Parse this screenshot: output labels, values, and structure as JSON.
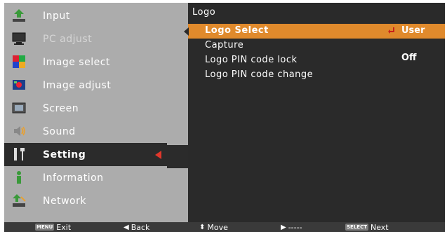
{
  "menu": {
    "items": [
      {
        "label": "Input",
        "icon": "input-icon"
      },
      {
        "label": "PC adjust",
        "icon": "pc-adjust-icon"
      },
      {
        "label": "Image select",
        "icon": "image-select-icon"
      },
      {
        "label": "Image adjust",
        "icon": "image-adjust-icon"
      },
      {
        "label": "Screen",
        "icon": "screen-icon"
      },
      {
        "label": "Sound",
        "icon": "sound-icon"
      },
      {
        "label": "Setting",
        "icon": "setting-icon"
      },
      {
        "label": "Information",
        "icon": "information-icon"
      },
      {
        "label": "Network",
        "icon": "network-icon"
      }
    ],
    "selected_index": 6
  },
  "panel": {
    "title": "Logo",
    "rows": [
      {
        "label": "Logo Select",
        "value": "User",
        "highlighted": true
      },
      {
        "label": "Capture",
        "value": ""
      },
      {
        "label": "Logo PIN code lock",
        "value": "Off"
      },
      {
        "label": "Logo PIN code change",
        "value": ""
      }
    ]
  },
  "bottom_bar": {
    "exit_key": "MENU",
    "exit_label": "Exit",
    "back_glyph": "◀",
    "back_label": "Back",
    "move_glyph": "⬍",
    "move_label": "Move",
    "next_glyph": "▶",
    "next_label": "-----",
    "select_key": "SELECT",
    "select_label": "Next"
  },
  "colors": {
    "osd_bg": "#acacac",
    "panel_bg": "#2a2a2a",
    "highlight": "#e08a2c",
    "accent_red": "#e2372b"
  }
}
